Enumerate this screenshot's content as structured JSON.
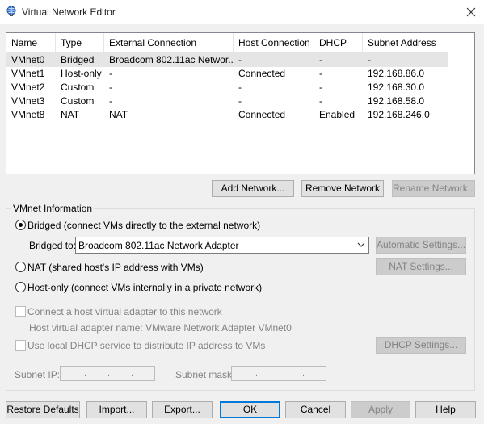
{
  "window": {
    "title": "Virtual Network Editor"
  },
  "table": {
    "columns": [
      "Name",
      "Type",
      "External Connection",
      "Host Connection",
      "DHCP",
      "Subnet Address"
    ],
    "rows": [
      [
        "VMnet0",
        "Bridged",
        "Broadcom 802.11ac Networ...",
        "-",
        "-",
        "-"
      ],
      [
        "VMnet1",
        "Host-only",
        "-",
        "Connected",
        "-",
        "192.168.86.0"
      ],
      [
        "VMnet2",
        "Custom",
        "-",
        "-",
        "-",
        "192.168.30.0"
      ],
      [
        "VMnet3",
        "Custom",
        "-",
        "-",
        "-",
        "192.168.58.0"
      ],
      [
        "VMnet8",
        "NAT",
        "NAT",
        "Connected",
        "Enabled",
        "192.168.246.0"
      ]
    ]
  },
  "network_buttons": {
    "add": "Add Network...",
    "remove": "Remove Network",
    "rename": "Rename Network..."
  },
  "info": {
    "label": "VMnet Information",
    "bridged_label": "Bridged (connect VMs directly to the external network)",
    "bridged_to_label": "Bridged to:",
    "bridged_to_value": "Broadcom 802.11ac Network Adapter",
    "auto_settings": "Automatic Settings...",
    "nat_label": "NAT (shared host's IP address with VMs)",
    "nat_settings": "NAT Settings...",
    "hostonly_label": "Host-only (connect VMs internally in a private network)",
    "connect_adapter_label": "Connect a host virtual adapter to this network",
    "adapter_name_label": "Host virtual adapter name: VMware Network Adapter VMnet0",
    "dhcp_label": "Use local DHCP service to distribute IP address to VMs",
    "dhcp_settings": "DHCP Settings...",
    "subnet_ip_label": "Subnet IP:",
    "subnet_mask_label": "Subnet mask:",
    "ip_dot": "."
  },
  "footer": {
    "restore": "Restore Defaults",
    "import": "Import...",
    "export": "Export...",
    "ok": "OK",
    "cancel": "Cancel",
    "apply": "Apply",
    "help": "Help"
  }
}
